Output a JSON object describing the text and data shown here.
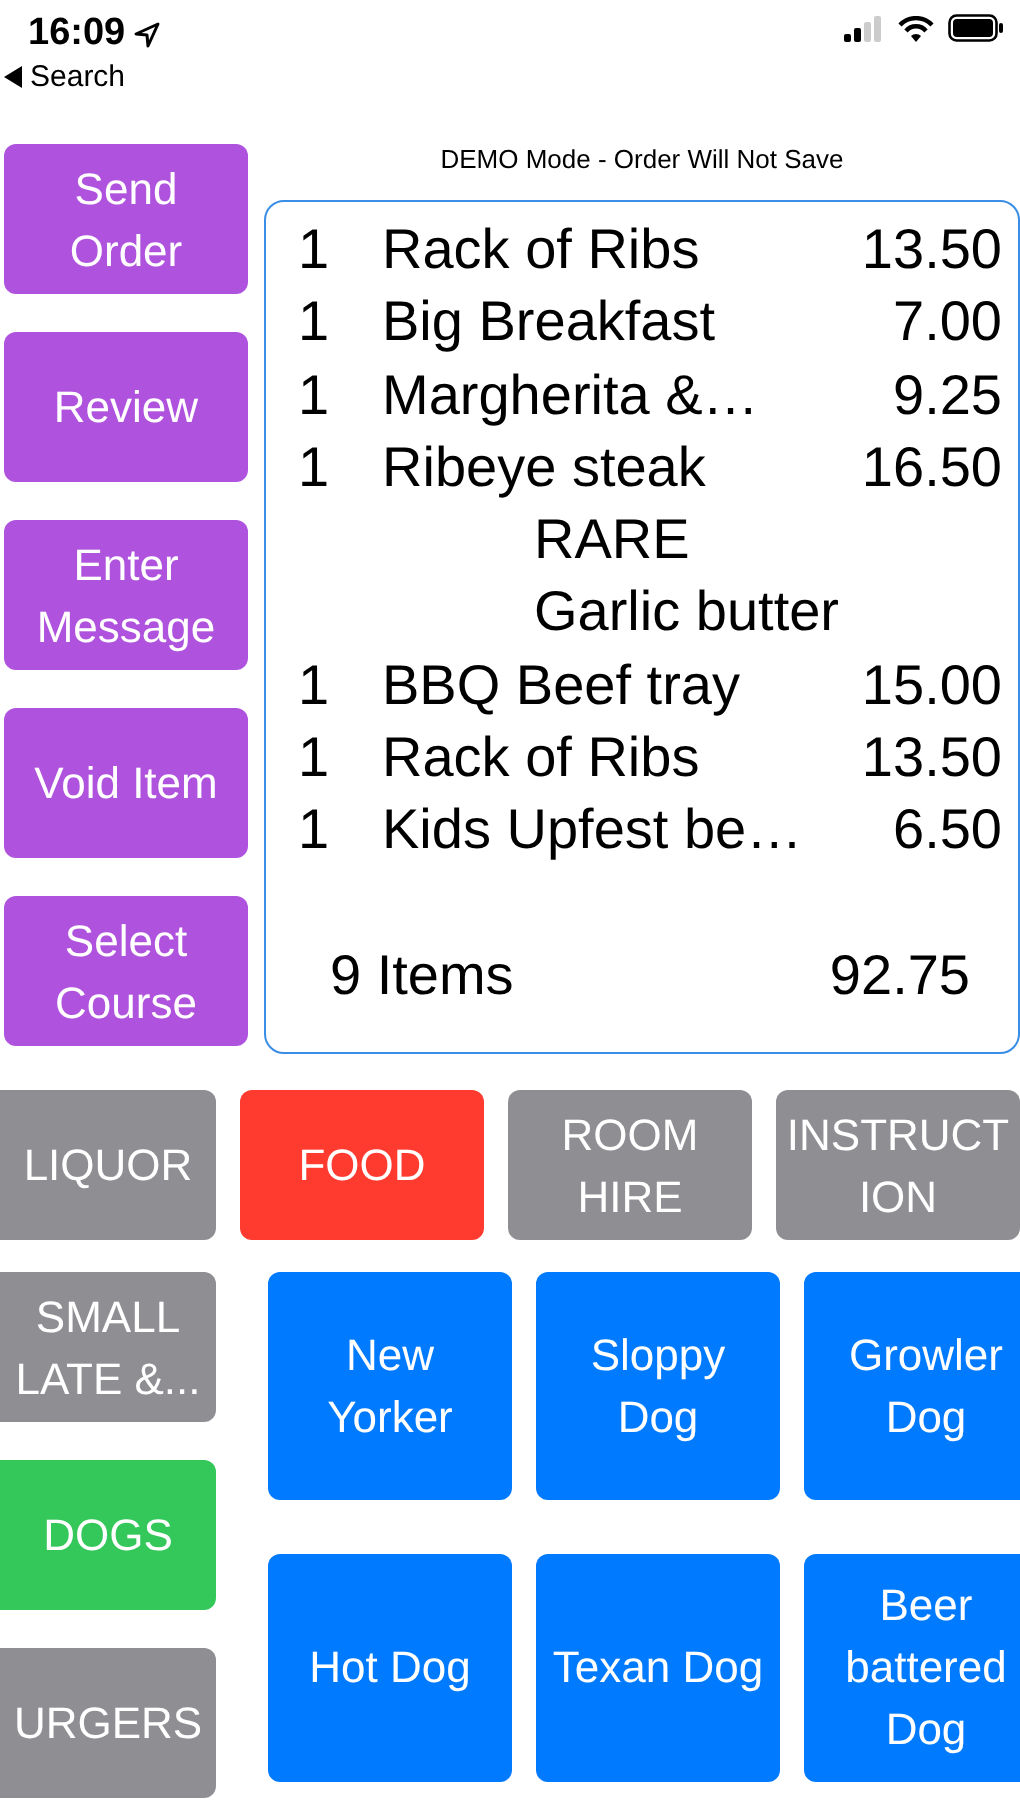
{
  "status_bar": {
    "time": "16:09",
    "back_label": "Search"
  },
  "actions": [
    "Send\nOrder",
    "Review",
    "Enter\nMessage",
    "Void Item",
    "Select\nCourse"
  ],
  "order": {
    "notice": "DEMO Mode - Order Will Not Save",
    "lines": [
      {
        "kind": "item",
        "qty": "1",
        "name": "Rack of Ribs",
        "price": "13.50"
      },
      {
        "kind": "item",
        "qty": "1",
        "name": "Big Breakfast",
        "price": "7.00"
      },
      {
        "kind": "item",
        "qty": "1",
        "name": "Margherita &…",
        "price": "9.25"
      },
      {
        "kind": "item",
        "qty": "1",
        "name": "Ribeye steak",
        "price": "16.50"
      },
      {
        "kind": "modifier",
        "name": "RARE"
      },
      {
        "kind": "modifier",
        "name": "Garlic butter"
      },
      {
        "kind": "item",
        "qty": "1",
        "name": "BBQ Beef tray",
        "price": "15.00"
      },
      {
        "kind": "item",
        "qty": "1",
        "name": "Rack of Ribs",
        "price": "13.50"
      },
      {
        "kind": "item",
        "qty": "1",
        "name": "Kids Upfest be…",
        "price": "6.50"
      }
    ],
    "count": "9 Items",
    "total": "92.75"
  },
  "categories_top": [
    {
      "label": "LIQUOR",
      "color": "#8e8e93"
    },
    {
      "label": "FOOD",
      "color": "#ff3b30"
    },
    {
      "label": "ROOM\nHIRE",
      "color": "#8e8e93"
    },
    {
      "label": "INSTRUCT\nION",
      "color": "#8e8e93"
    }
  ],
  "categories_side": [
    {
      "label": "SMALL\nLATE &...",
      "color": "#8e8e93"
    },
    {
      "label": "DOGS",
      "color": "#34c759"
    },
    {
      "label": "URGERS",
      "color": "#8e8e93"
    }
  ],
  "products": [
    "New\nYorker",
    "Sloppy\nDog",
    "Growler\nDog",
    "Hot Dog",
    "Texan Dog",
    "Beer\nbattered\nDog"
  ]
}
